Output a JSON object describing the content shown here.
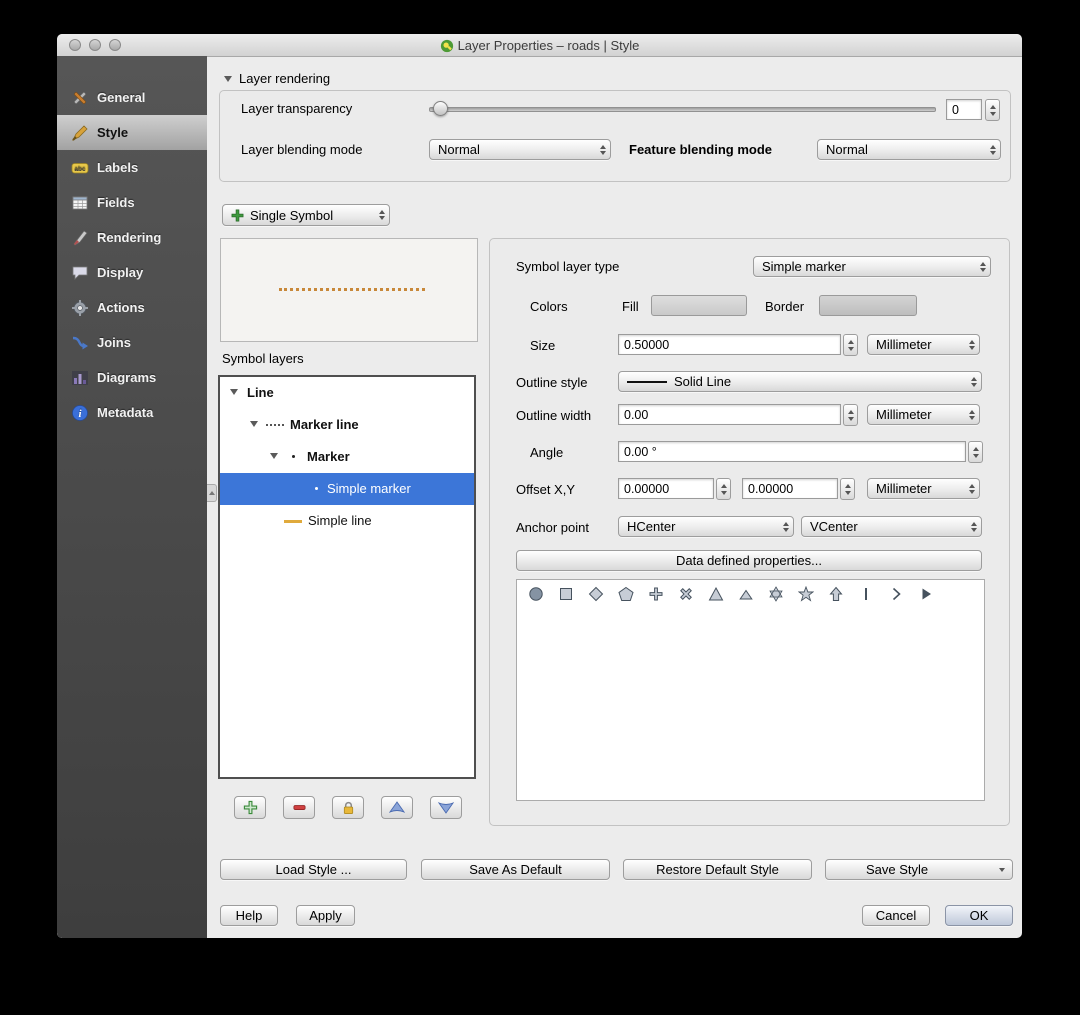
{
  "window": {
    "title": "Layer Properties – roads | Style"
  },
  "sidebar": {
    "items": [
      {
        "label": "General"
      },
      {
        "label": "Style"
      },
      {
        "label": "Labels"
      },
      {
        "label": "Fields"
      },
      {
        "label": "Rendering"
      },
      {
        "label": "Display"
      },
      {
        "label": "Actions"
      },
      {
        "label": "Joins"
      },
      {
        "label": "Diagrams"
      },
      {
        "label": "Metadata"
      }
    ]
  },
  "layer_rendering": {
    "header": "Layer rendering",
    "transparency_label": "Layer transparency",
    "transparency_value": "0",
    "blending_mode_label": "Layer blending mode",
    "blending_mode_value": "Normal",
    "feature_blending_label": "Feature blending mode",
    "feature_blending_value": "Normal"
  },
  "symbol_selector": {
    "value": "Single Symbol"
  },
  "symbol_layers": {
    "label": "Symbol layers",
    "tree": [
      {
        "label": "Line"
      },
      {
        "label": "Marker line"
      },
      {
        "label": "Marker"
      },
      {
        "label": "Simple marker"
      },
      {
        "label": "Simple line"
      }
    ]
  },
  "properties": {
    "symbol_layer_type_label": "Symbol layer type",
    "symbol_layer_type_value": "Simple marker",
    "colors_label": "Colors",
    "fill_label": "Fill",
    "border_label": "Border",
    "size_label": "Size",
    "size_value": "0.50000",
    "size_unit": "Millimeter",
    "outline_style_label": "Outline style",
    "outline_style_value": "Solid Line",
    "outline_width_label": "Outline width",
    "outline_width_value": "0.00",
    "outline_width_unit": "Millimeter",
    "angle_label": "Angle",
    "angle_value": "0.00 °",
    "offset_label": "Offset X,Y",
    "offset_x_value": "0.00000",
    "offset_y_value": "0.00000",
    "offset_unit": "Millimeter",
    "anchor_label": "Anchor point",
    "anchor_h_value": "HCenter",
    "anchor_v_value": "VCenter",
    "data_defined_button": "Data defined properties..."
  },
  "marker_shapes": [
    "circle",
    "square",
    "diamond",
    "pentagon",
    "cross",
    "cross-x",
    "triangle",
    "equilateral-triangle",
    "star",
    "regular-star",
    "arrow-up",
    "vertical-line",
    "chevron-right",
    "filled-arrowhead"
  ],
  "footer": {
    "load_style": "Load Style ...",
    "save_as_default": "Save As Default",
    "restore_default": "Restore Default Style",
    "save_style": "Save Style",
    "help": "Help",
    "apply": "Apply",
    "cancel": "Cancel",
    "ok": "OK"
  },
  "colors": {
    "selection_blue": "#3c76d8",
    "sidebar_bg": "#4a4a4a",
    "marker_preview_dots": "#c8883a",
    "fill_swatch": "#d2d2d2",
    "border_swatch": "#c6c6c6"
  }
}
